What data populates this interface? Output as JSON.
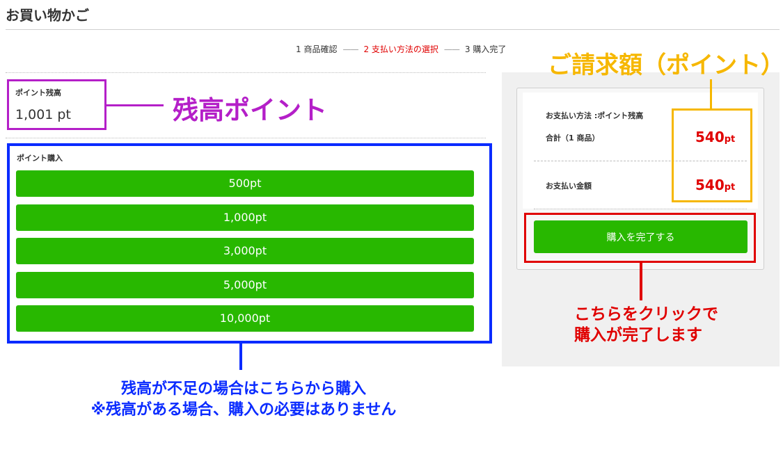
{
  "page": {
    "title": "お買い物かご"
  },
  "steps": [
    {
      "label": "1 商品確認"
    },
    {
      "label": "2 支払い方法の選択"
    },
    {
      "label": "3 購入完了"
    }
  ],
  "steps_separator": "——",
  "balance": {
    "label": "ポイント残高",
    "value": "1,001 pt"
  },
  "purchase": {
    "label": "ポイント購入",
    "options": [
      "500pt",
      "1,000pt",
      "3,000pt",
      "5,000pt",
      "10,000pt"
    ]
  },
  "summary": {
    "method_label": "お支払い方法 :ポイント残高",
    "total_label": "合計（1 商品）",
    "total_amount": "540",
    "total_unit": "pt",
    "pay_label": "お支払い金額",
    "pay_amount": "540",
    "pay_unit": "pt",
    "complete_button": "購入を完了する"
  },
  "annotations": {
    "balance": "残高ポイント",
    "billing": "ご請求額（ポイント）",
    "click_line1": "こちらをクリックで",
    "click_line2": "購入が完了します",
    "purchase_line1": "残高が不足の場合はこちらから購入",
    "purchase_line2": "※残高がある場合、購入の必要はありません"
  },
  "colors": {
    "button_green": "#28b800",
    "active_step": "#e00000",
    "annotation_purple": "#b41fc8",
    "annotation_blue": "#0a2bff",
    "annotation_yellow": "#f6b700",
    "annotation_red": "#e00000"
  }
}
